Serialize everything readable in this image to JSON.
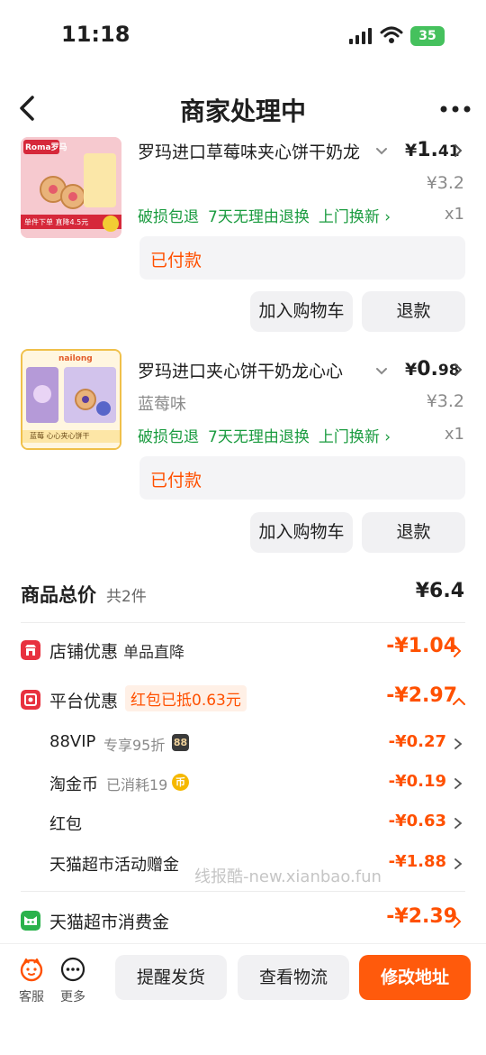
{
  "status": {
    "time": "11:18",
    "battery": "35"
  },
  "nav": {
    "title": "商家处理中"
  },
  "products": [
    {
      "title": "罗玛进口草莓味夹心饼干奶龙",
      "price_cur": "¥",
      "price_int": "1.",
      "price_dec": "41",
      "orig_price": "¥3.2",
      "variant": "",
      "tags": [
        "破损包退",
        "7天无理由退换",
        "上门换新 ›"
      ],
      "qty": "x1",
      "status": "已付款",
      "add_cart": "加入购物车",
      "refund": "退款",
      "thumb_text_top": "Roma罗马",
      "thumb_text_bottom": "单件下单 直降4.5元"
    },
    {
      "title": "罗玛进口夹心饼干奶龙心心",
      "price_cur": "¥",
      "price_int": "0.",
      "price_dec": "98",
      "orig_price": "¥3.2",
      "variant": "蓝莓味",
      "tags": [
        "破损包退",
        "7天无理由退换",
        "上门换新 ›"
      ],
      "qty": "x1",
      "status": "已付款",
      "add_cart": "加入购物车",
      "refund": "退款",
      "thumb_text_top": "nailong",
      "thumb_text_bottom": "蓝莓 心心夹心饼干"
    }
  ],
  "total": {
    "label": "商品总价",
    "count": "共2件",
    "amount": "¥6.4"
  },
  "discounts": [
    {
      "label": "店铺优惠",
      "sub": "单品直降",
      "amount": "-¥1.04",
      "icon": "shop-icon",
      "color": "#e8313f"
    },
    {
      "label": "平台优惠",
      "badge": "红包已抵0.63元",
      "amount": "-¥2.97",
      "icon": "platform-coupon-icon",
      "color": "#e8313f"
    }
  ],
  "sub_items": [
    {
      "label": "88VIP",
      "note": "专享95折",
      "badge": "88",
      "amount": "-¥0.27"
    },
    {
      "label": "淘金币",
      "note": "已消耗19",
      "badge": "币",
      "amount": "-¥0.19"
    },
    {
      "label": "红包",
      "note": "",
      "badge": "",
      "amount": "-¥0.63"
    },
    {
      "label": "天猫超市活动赠金",
      "note": "",
      "badge": "",
      "amount": "-¥1.88"
    }
  ],
  "consume": {
    "label": "天猫超市消费金",
    "amount": "-¥2.39",
    "color": "#2bb24c"
  },
  "watermark": "线报酷-new.xianbao.fun",
  "bottom": {
    "service": "客服",
    "more": "更多",
    "remind": "提醒发货",
    "logistics": "查看物流",
    "change_address": "修改地址"
  }
}
